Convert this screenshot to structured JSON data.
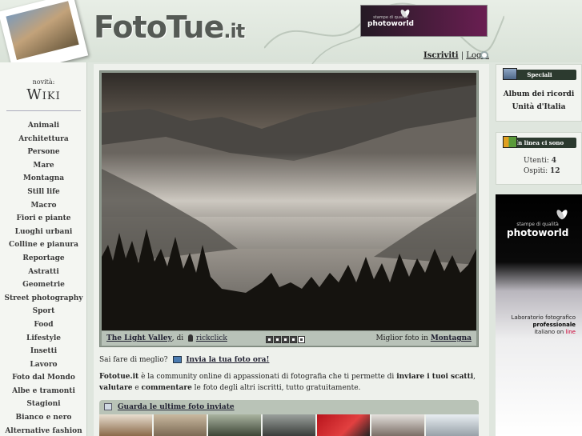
{
  "header": {
    "logo_main": "FotoTue",
    "logo_tld": ".it",
    "banner_brand": "photoworld",
    "banner_tagline": "stampe di qualità"
  },
  "auth": {
    "register": "Iscriviti",
    "separator": "|",
    "login": "Login"
  },
  "sidebar": {
    "wiki_new": "novità:",
    "wiki_title": "Wiki",
    "categories": [
      "Animali",
      "Architettura",
      "Persone",
      "Mare",
      "Montagna",
      "Still life",
      "Macro",
      "Fiori e piante",
      "Luoghi urbani",
      "Colline e pianura",
      "Reportage",
      "Astratti",
      "Geometrie",
      "Street photography",
      "Sport",
      "Food",
      "Lifestyle",
      "Insetti",
      "Lavoro",
      "Foto dal Mondo",
      "Albe e tramonti",
      "Stagioni",
      "Bianco e nero",
      "Alternative fashion"
    ]
  },
  "featured": {
    "title": "The Light Valley",
    "by": ", di",
    "user": "rickclick",
    "rating": 4,
    "rating_max": 5,
    "best_label": "Miglior foto in",
    "best_category": "Montagna"
  },
  "cta": {
    "question": "Sai fare di meglio?",
    "link": "Invia la tua foto ora!"
  },
  "description": {
    "brand": "Fototue.it",
    "part1": " è la community online di appassionati di fotografia che ti permette di ",
    "emph1": "inviare i tuoi scatti",
    "sep1": ", ",
    "emph2": "valutare",
    "sep2": " e ",
    "emph3": "commentare",
    "part2": " le foto degli altri iscritti, tutto gratuitamente."
  },
  "latest": {
    "link": "Guarda le ultime foto inviate"
  },
  "specials": {
    "heading": "Speciali",
    "items": [
      "Album dei ricordi",
      "Unità d'Italia"
    ]
  },
  "online": {
    "heading": "In linea ci sono",
    "users_label": "Utenti:",
    "users": "4",
    "guests_label": "Ospiti:",
    "guests": "12"
  },
  "side_banner": {
    "brand": "photoworld",
    "tagline": "stampe di qualità",
    "line1": "Laboratorio fotografico",
    "line2": "professionale",
    "line3a": "italiano on ",
    "line3b": "line"
  },
  "colors": {
    "caption_bar": "#b8c2b8",
    "sidebar_bg": "#f4f6f2",
    "box_header": "#2c3a2f",
    "banner_accent": "#6a1e52"
  }
}
